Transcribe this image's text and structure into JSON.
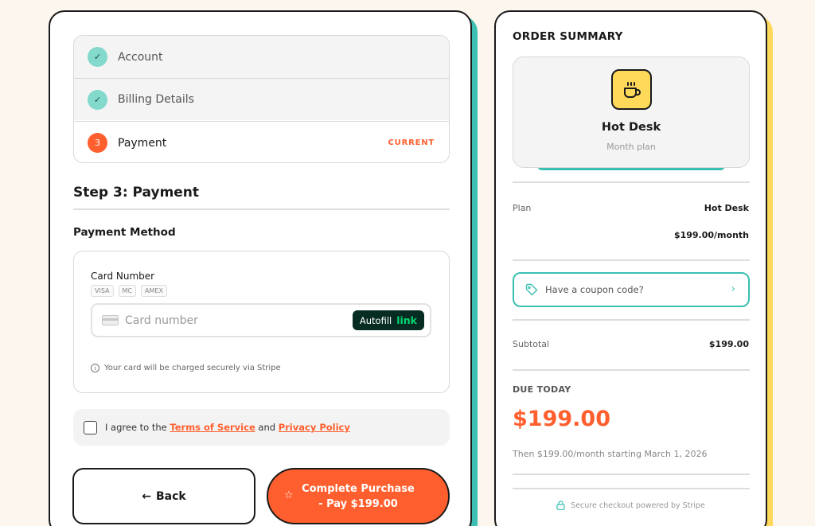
{
  "steps": [
    {
      "label": "Account",
      "status": "done"
    },
    {
      "label": "Billing Details",
      "status": "done"
    },
    {
      "label": "Payment",
      "number": "3",
      "badge": "CURRENT"
    }
  ],
  "payment": {
    "step_title": "Step 3: Payment",
    "method_label": "Payment Method",
    "card_number_label": "Card Number",
    "brands": [
      "VISA",
      "MC",
      "AMEX"
    ],
    "card_placeholder": "Card number",
    "autofill_label": "Autofill",
    "autofill_link": "link",
    "secure_note": "Your card will be charged securely via Stripe"
  },
  "agreement": {
    "prefix": "I agree to the",
    "terms": "Terms of Service",
    "and": "and",
    "privacy": "Privacy Policy"
  },
  "buttons": {
    "back": "Back",
    "complete": "Complete Purchase - Pay $199.00"
  },
  "summary": {
    "title": "ORDER SUMMARY",
    "product_name": "Hot Desk",
    "product_sub": "Month plan",
    "plan_label": "Plan",
    "plan_value": "Hot Desk",
    "plan_price": "$199.00/month",
    "coupon_placeholder": "Have a coupon code?",
    "subtotal_label": "Subtotal",
    "subtotal_value": "$199.00",
    "due_label": "DUE TODAY",
    "due_amount": "$199.00",
    "due_note": "Then $199.00/month starting March 1, 2026",
    "secure_footer": "Secure checkout powered by Stripe"
  },
  "colors": {
    "accent": "#ff5f2e",
    "teal": "#3bbfb2",
    "yellow": "#ffd95a",
    "link_green": "#00d66f"
  },
  "icons": [
    "check-icon",
    "card-icon",
    "info-icon",
    "arrow-left-icon",
    "star-icon",
    "coffee-cup-icon",
    "tag-icon",
    "chevron-right-icon",
    "lock-icon"
  ]
}
